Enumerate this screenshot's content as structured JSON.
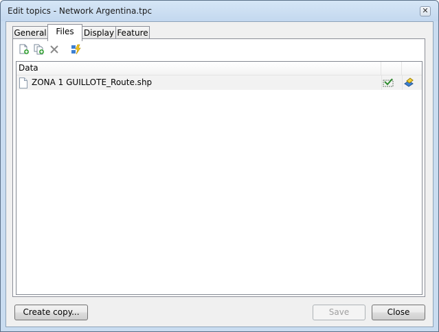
{
  "window": {
    "title": "Edit topics - Network Argentina.tpc",
    "close_glyph": "✕"
  },
  "tabs": [
    {
      "label": "General",
      "active": false
    },
    {
      "label": "Files",
      "active": true
    },
    {
      "label": "Display",
      "active": false
    },
    {
      "label": "Feature",
      "active": false
    }
  ],
  "toolbar": {
    "items": [
      {
        "name": "new-file-icon",
        "enabled": true
      },
      {
        "name": "copy-file-icon",
        "enabled": true
      },
      {
        "name": "delete-icon",
        "enabled": false
      },
      {
        "name": "refresh-lightning-icon",
        "enabled": true
      }
    ]
  },
  "list": {
    "columns": [
      {
        "label": "Data"
      },
      {
        "label": ""
      },
      {
        "label": ""
      }
    ],
    "rows": [
      {
        "name": "ZONA 1 GUILLOTE_Route.shp",
        "icon": "document-icon",
        "actions": [
          "check-shape-icon",
          "layer-style-icon"
        ]
      }
    ]
  },
  "footer": {
    "create_copy": "Create copy...",
    "save": "Save",
    "close": "Close"
  },
  "colors": {
    "frame": "#c9dcf0",
    "client": "#f0f0f0",
    "row": "#f2f2f2"
  }
}
